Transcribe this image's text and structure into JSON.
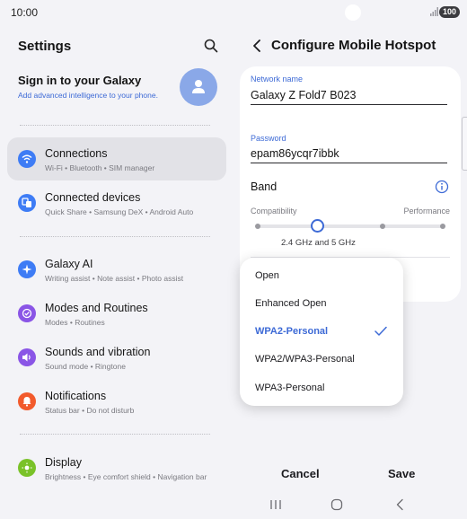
{
  "status_bar": {
    "time": "10:00",
    "battery": "100"
  },
  "settings": {
    "title": "Settings",
    "account": {
      "title": "Sign in to your Galaxy",
      "subtitle": "Add advanced intelligence to your phone."
    },
    "items": [
      {
        "label": "Connections",
        "sub": "Wi-Fi • Bluetooth • SIM manager",
        "icon": "wifi-icon",
        "color": "#3e7cf5"
      },
      {
        "label": "Connected devices",
        "sub": "Quick Share • Samsung DeX • Android Auto",
        "icon": "connected-devices-icon",
        "color": "#3e7cf5"
      },
      {
        "label": "Galaxy AI",
        "sub": "Writing assist • Note assist • Photo assist",
        "icon": "galaxy-ai-icon",
        "color": "#3e7cf5"
      },
      {
        "label": "Modes and Routines",
        "sub": "Modes • Routines",
        "icon": "modes-icon",
        "color": "#8a55e6"
      },
      {
        "label": "Sounds and vibration",
        "sub": "Sound mode • Ringtone",
        "icon": "sound-icon",
        "color": "#8a55e6"
      },
      {
        "label": "Notifications",
        "sub": "Status bar • Do not disturb",
        "icon": "notification-icon",
        "color": "#f25a2c"
      },
      {
        "label": "Display",
        "sub": "Brightness • Eye comfort shield • Navigation bar",
        "icon": "display-icon",
        "color": "#7ac229"
      }
    ]
  },
  "hotspot": {
    "title": "Configure Mobile Hotspot",
    "network_name_label": "Network name",
    "network_name_value": "Galaxy Z Fold7 B023",
    "password_label": "Password",
    "password_value": "epam86ycqr7ibbk",
    "band_label": "Band",
    "compatibility_label": "Compatibility",
    "performance_label": "Performance",
    "band_value": "2.4 GHz and 5 GHz",
    "band_level": 0.33
  },
  "security_dropdown": {
    "options": [
      "Open",
      "Enhanced Open",
      "WPA2-Personal",
      "WPA2/WPA3-Personal",
      "WPA3-Personal"
    ],
    "selected": "WPA2-Personal"
  },
  "actions": {
    "cancel": "Cancel",
    "save": "Save"
  },
  "colors": {
    "accent": "#3d6ad6",
    "background": "#f3f3f7"
  }
}
